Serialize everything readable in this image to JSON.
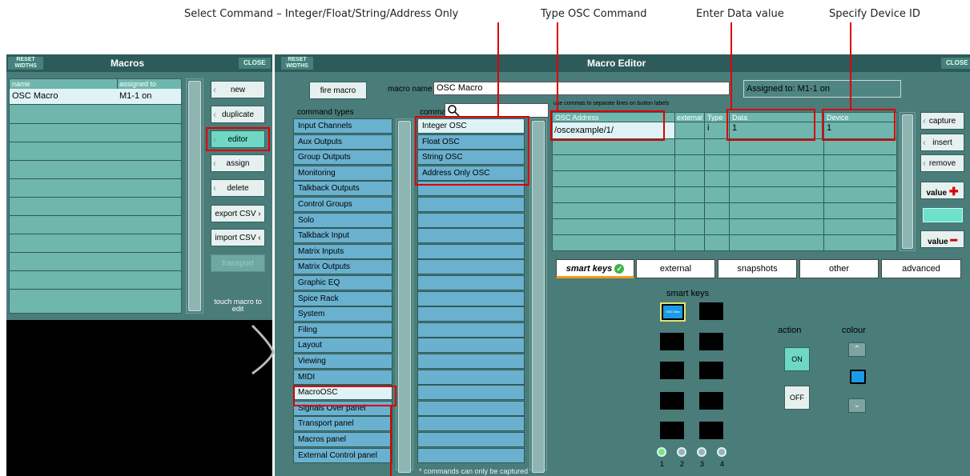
{
  "callouts": {
    "select_command": "Select Command – Integer/Float/String/Address Only",
    "type_osc": "Type OSC Command",
    "enter_data": "Enter Data value",
    "device_id": "Specify Device ID"
  },
  "macros_panel": {
    "reset_widths": "RESET WIDTHS",
    "title": "Macros",
    "close": "CLOSE",
    "columns": [
      "name",
      "assigned to"
    ],
    "rows": [
      {
        "name": "OSC Macro",
        "assigned": "M1-1 on"
      }
    ],
    "buttons": {
      "new": "new",
      "duplicate": "duplicate",
      "editor": "editor",
      "assign": "assign",
      "delete": "delete",
      "export": "export CSV",
      "import": "import CSV",
      "transport": "transport"
    },
    "hint": "touch macro to edit"
  },
  "editor": {
    "reset_widths": "RESET WIDTHS",
    "title": "Macro Editor",
    "close": "CLOSE",
    "fire_macro": "fire macro",
    "macro_name_label": "macro name",
    "macro_name_value": "OSC Macro",
    "assigned_to": "Assigned to: M1-1 on",
    "command_types_header": "command types",
    "commands_header": "commands",
    "command_types": [
      "Input Channels",
      "Aux Outputs",
      "Group Outputs",
      "Monitoring",
      "Talkback Outputs",
      "Control Groups",
      "Solo",
      "Talkback Input",
      "Matrix Inputs",
      "Matrix Outputs",
      "Graphic EQ",
      "Spice Rack",
      "System",
      "Filing",
      "Layout",
      "Viewing",
      "MIDI",
      "MacroOSC",
      "Signals Over panel",
      "Transport panel",
      "Macros panel",
      "External Control panel"
    ],
    "commands": [
      "Integer OSC",
      "Float OSC",
      "String OSC",
      "Address Only OSC"
    ],
    "commands_note": "* commands can only be captured",
    "table_hint": "use commas to separate lines on button labels",
    "table_columns": [
      "OSC Address",
      "external",
      "Type",
      "Data",
      "Device"
    ],
    "table_rows": [
      {
        "address": "/oscexample/1/",
        "external": "",
        "type": "i",
        "data": "1",
        "device": "1"
      }
    ],
    "side_buttons": {
      "capture": "capture",
      "insert": "insert",
      "remove": "remove",
      "value_plus": "value",
      "value_minus": "value"
    },
    "tabs": [
      "smart keys",
      "external",
      "snapshots",
      "other",
      "advanced"
    ],
    "smart_keys_title": "smart keys",
    "smart_key_label": "OSC Mac",
    "action_label": "action",
    "colour_label": "colour",
    "on": "ON",
    "off": "OFF",
    "pages": [
      "1",
      "2",
      "3",
      "4"
    ]
  },
  "colors": {
    "panel": "#4a7c7a",
    "titlebar": "#2d5b5a",
    "list": "#6ab1cf",
    "grid": "#6fb6ad",
    "highlight": "#dff3f6",
    "accent": "#d00000",
    "active": "#6fd8c5"
  }
}
